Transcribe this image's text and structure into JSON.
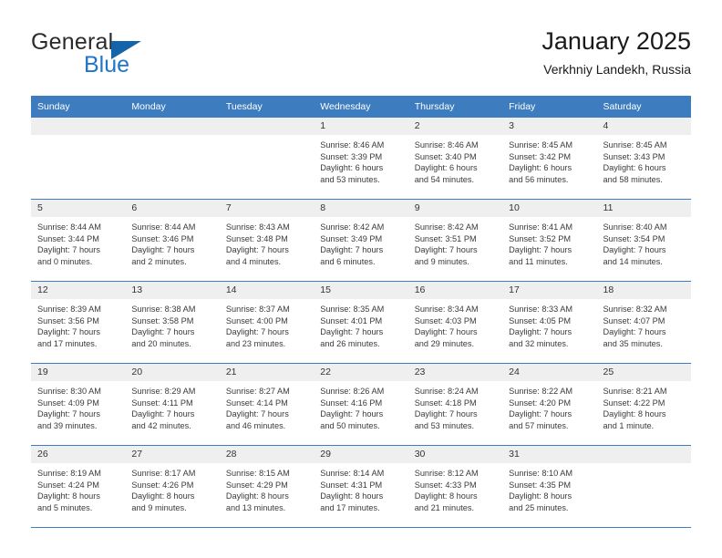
{
  "brand": {
    "word_general": "General",
    "word_blue": "Blue",
    "triangle_color": "#1464aa",
    "blue_color": "#2076c6"
  },
  "header": {
    "title": "January 2025",
    "subtitle": "Verkhniy Landekh, Russia"
  },
  "theme": {
    "header_bg": "#3d7dbf",
    "daynum_bg": "#efefef",
    "grid_line": "#3d7dbf"
  },
  "weekday_headers": [
    "Sunday",
    "Monday",
    "Tuesday",
    "Wednesday",
    "Thursday",
    "Friday",
    "Saturday"
  ],
  "weeks": [
    [
      {
        "day": "",
        "sunrise": "",
        "sunset": "",
        "daylight1": "",
        "daylight2": ""
      },
      {
        "day": "",
        "sunrise": "",
        "sunset": "",
        "daylight1": "",
        "daylight2": ""
      },
      {
        "day": "",
        "sunrise": "",
        "sunset": "",
        "daylight1": "",
        "daylight2": ""
      },
      {
        "day": "1",
        "sunrise": "Sunrise: 8:46 AM",
        "sunset": "Sunset: 3:39 PM",
        "daylight1": "Daylight: 6 hours",
        "daylight2": "and 53 minutes."
      },
      {
        "day": "2",
        "sunrise": "Sunrise: 8:46 AM",
        "sunset": "Sunset: 3:40 PM",
        "daylight1": "Daylight: 6 hours",
        "daylight2": "and 54 minutes."
      },
      {
        "day": "3",
        "sunrise": "Sunrise: 8:45 AM",
        "sunset": "Sunset: 3:42 PM",
        "daylight1": "Daylight: 6 hours",
        "daylight2": "and 56 minutes."
      },
      {
        "day": "4",
        "sunrise": "Sunrise: 8:45 AM",
        "sunset": "Sunset: 3:43 PM",
        "daylight1": "Daylight: 6 hours",
        "daylight2": "and 58 minutes."
      }
    ],
    [
      {
        "day": "5",
        "sunrise": "Sunrise: 8:44 AM",
        "sunset": "Sunset: 3:44 PM",
        "daylight1": "Daylight: 7 hours",
        "daylight2": "and 0 minutes."
      },
      {
        "day": "6",
        "sunrise": "Sunrise: 8:44 AM",
        "sunset": "Sunset: 3:46 PM",
        "daylight1": "Daylight: 7 hours",
        "daylight2": "and 2 minutes."
      },
      {
        "day": "7",
        "sunrise": "Sunrise: 8:43 AM",
        "sunset": "Sunset: 3:48 PM",
        "daylight1": "Daylight: 7 hours",
        "daylight2": "and 4 minutes."
      },
      {
        "day": "8",
        "sunrise": "Sunrise: 8:42 AM",
        "sunset": "Sunset: 3:49 PM",
        "daylight1": "Daylight: 7 hours",
        "daylight2": "and 6 minutes."
      },
      {
        "day": "9",
        "sunrise": "Sunrise: 8:42 AM",
        "sunset": "Sunset: 3:51 PM",
        "daylight1": "Daylight: 7 hours",
        "daylight2": "and 9 minutes."
      },
      {
        "day": "10",
        "sunrise": "Sunrise: 8:41 AM",
        "sunset": "Sunset: 3:52 PM",
        "daylight1": "Daylight: 7 hours",
        "daylight2": "and 11 minutes."
      },
      {
        "day": "11",
        "sunrise": "Sunrise: 8:40 AM",
        "sunset": "Sunset: 3:54 PM",
        "daylight1": "Daylight: 7 hours",
        "daylight2": "and 14 minutes."
      }
    ],
    [
      {
        "day": "12",
        "sunrise": "Sunrise: 8:39 AM",
        "sunset": "Sunset: 3:56 PM",
        "daylight1": "Daylight: 7 hours",
        "daylight2": "and 17 minutes."
      },
      {
        "day": "13",
        "sunrise": "Sunrise: 8:38 AM",
        "sunset": "Sunset: 3:58 PM",
        "daylight1": "Daylight: 7 hours",
        "daylight2": "and 20 minutes."
      },
      {
        "day": "14",
        "sunrise": "Sunrise: 8:37 AM",
        "sunset": "Sunset: 4:00 PM",
        "daylight1": "Daylight: 7 hours",
        "daylight2": "and 23 minutes."
      },
      {
        "day": "15",
        "sunrise": "Sunrise: 8:35 AM",
        "sunset": "Sunset: 4:01 PM",
        "daylight1": "Daylight: 7 hours",
        "daylight2": "and 26 minutes."
      },
      {
        "day": "16",
        "sunrise": "Sunrise: 8:34 AM",
        "sunset": "Sunset: 4:03 PM",
        "daylight1": "Daylight: 7 hours",
        "daylight2": "and 29 minutes."
      },
      {
        "day": "17",
        "sunrise": "Sunrise: 8:33 AM",
        "sunset": "Sunset: 4:05 PM",
        "daylight1": "Daylight: 7 hours",
        "daylight2": "and 32 minutes."
      },
      {
        "day": "18",
        "sunrise": "Sunrise: 8:32 AM",
        "sunset": "Sunset: 4:07 PM",
        "daylight1": "Daylight: 7 hours",
        "daylight2": "and 35 minutes."
      }
    ],
    [
      {
        "day": "19",
        "sunrise": "Sunrise: 8:30 AM",
        "sunset": "Sunset: 4:09 PM",
        "daylight1": "Daylight: 7 hours",
        "daylight2": "and 39 minutes."
      },
      {
        "day": "20",
        "sunrise": "Sunrise: 8:29 AM",
        "sunset": "Sunset: 4:11 PM",
        "daylight1": "Daylight: 7 hours",
        "daylight2": "and 42 minutes."
      },
      {
        "day": "21",
        "sunrise": "Sunrise: 8:27 AM",
        "sunset": "Sunset: 4:14 PM",
        "daylight1": "Daylight: 7 hours",
        "daylight2": "and 46 minutes."
      },
      {
        "day": "22",
        "sunrise": "Sunrise: 8:26 AM",
        "sunset": "Sunset: 4:16 PM",
        "daylight1": "Daylight: 7 hours",
        "daylight2": "and 50 minutes."
      },
      {
        "day": "23",
        "sunrise": "Sunrise: 8:24 AM",
        "sunset": "Sunset: 4:18 PM",
        "daylight1": "Daylight: 7 hours",
        "daylight2": "and 53 minutes."
      },
      {
        "day": "24",
        "sunrise": "Sunrise: 8:22 AM",
        "sunset": "Sunset: 4:20 PM",
        "daylight1": "Daylight: 7 hours",
        "daylight2": "and 57 minutes."
      },
      {
        "day": "25",
        "sunrise": "Sunrise: 8:21 AM",
        "sunset": "Sunset: 4:22 PM",
        "daylight1": "Daylight: 8 hours",
        "daylight2": "and 1 minute."
      }
    ],
    [
      {
        "day": "26",
        "sunrise": "Sunrise: 8:19 AM",
        "sunset": "Sunset: 4:24 PM",
        "daylight1": "Daylight: 8 hours",
        "daylight2": "and 5 minutes."
      },
      {
        "day": "27",
        "sunrise": "Sunrise: 8:17 AM",
        "sunset": "Sunset: 4:26 PM",
        "daylight1": "Daylight: 8 hours",
        "daylight2": "and 9 minutes."
      },
      {
        "day": "28",
        "sunrise": "Sunrise: 8:15 AM",
        "sunset": "Sunset: 4:29 PM",
        "daylight1": "Daylight: 8 hours",
        "daylight2": "and 13 minutes."
      },
      {
        "day": "29",
        "sunrise": "Sunrise: 8:14 AM",
        "sunset": "Sunset: 4:31 PM",
        "daylight1": "Daylight: 8 hours",
        "daylight2": "and 17 minutes."
      },
      {
        "day": "30",
        "sunrise": "Sunrise: 8:12 AM",
        "sunset": "Sunset: 4:33 PM",
        "daylight1": "Daylight: 8 hours",
        "daylight2": "and 21 minutes."
      },
      {
        "day": "31",
        "sunrise": "Sunrise: 8:10 AM",
        "sunset": "Sunset: 4:35 PM",
        "daylight1": "Daylight: 8 hours",
        "daylight2": "and 25 minutes."
      },
      {
        "day": "",
        "sunrise": "",
        "sunset": "",
        "daylight1": "",
        "daylight2": ""
      }
    ]
  ]
}
